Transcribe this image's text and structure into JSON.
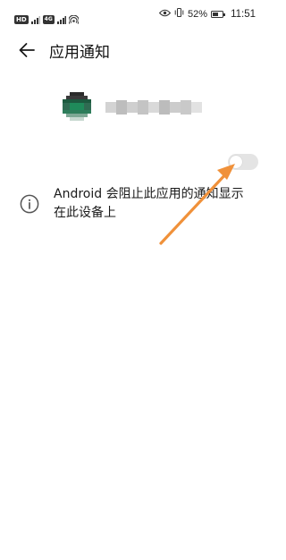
{
  "status_bar": {
    "left_badge": "HD",
    "battery": "52%",
    "time": "11:51"
  },
  "header": {
    "title": "应用通知"
  },
  "notification_toggle": {
    "state": "off"
  },
  "info": {
    "text": "Android 会阻止此应用的通知显示在此设备上"
  },
  "colors": {
    "annotation_arrow": "#f0913a",
    "toggle_track_off": "#e4e4e4",
    "app_icon_green": "#1f8a5a"
  }
}
